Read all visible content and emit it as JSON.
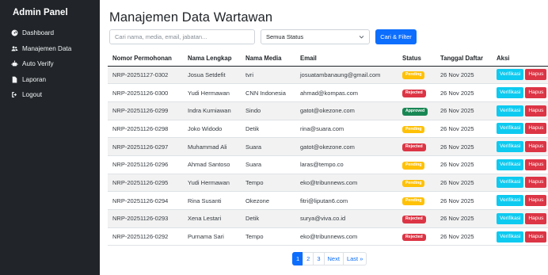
{
  "sidebar": {
    "brand": "Admin Panel",
    "items": [
      {
        "label": "Dashboard",
        "icon": "gauge-icon"
      },
      {
        "label": "Manajemen Data",
        "icon": "users-icon"
      },
      {
        "label": "Auto Verify",
        "icon": "robot-icon"
      },
      {
        "label": "Laporan",
        "icon": "file-icon"
      },
      {
        "label": "Logout",
        "icon": "logout-icon"
      }
    ]
  },
  "main": {
    "title": "Manajemen Data Wartawan",
    "search_placeholder": "Cari nama, media, email, jabatan...",
    "status_select": "Semua Status",
    "filter_button": "Cari & Filter"
  },
  "table": {
    "headers": [
      "Nomor Permohonan",
      "Nama Lengkap",
      "Nama Media",
      "Email",
      "Status",
      "Tanggal Daftar",
      "Aksi"
    ],
    "rows": [
      {
        "nomor": "NRP-20251127-0302",
        "nama": "Josua Setdefit",
        "media": "tvri",
        "email": "josuatambanaung@gmail.com",
        "status": "Pending",
        "tanggal": "26 Nov 2025"
      },
      {
        "nomor": "NRP-20251126-0300",
        "nama": "Yudi Hermawan",
        "media": "CNN Indonesia",
        "email": "ahmad@kompas.com",
        "status": "Rejected",
        "tanggal": "26 Nov 2025"
      },
      {
        "nomor": "NRP-20251126-0299",
        "nama": "Indra Kurniawan",
        "media": "Sindo",
        "email": "gatot@okezone.com",
        "status": "Approved",
        "tanggal": "26 Nov 2025"
      },
      {
        "nomor": "NRP-20251126-0298",
        "nama": "Joko Widodo",
        "media": "Detik",
        "email": "rina@suara.com",
        "status": "Pending",
        "tanggal": "26 Nov 2025"
      },
      {
        "nomor": "NRP-20251126-0297",
        "nama": "Muhammad Ali",
        "media": "Suara",
        "email": "gatot@okezone.com",
        "status": "Rejected",
        "tanggal": "26 Nov 2025"
      },
      {
        "nomor": "NRP-20251126-0296",
        "nama": "Ahmad Santoso",
        "media": "Suara",
        "email": "laras@tempo.co",
        "status": "Pending",
        "tanggal": "26 Nov 2025"
      },
      {
        "nomor": "NRP-20251126-0295",
        "nama": "Yudi Hermawan",
        "media": "Tempo",
        "email": "eko@tribunnews.com",
        "status": "Pending",
        "tanggal": "26 Nov 2025"
      },
      {
        "nomor": "NRP-20251126-0294",
        "nama": "Rina Susanti",
        "media": "Okezone",
        "email": "fitri@liputan6.com",
        "status": "Pending",
        "tanggal": "26 Nov 2025"
      },
      {
        "nomor": "NRP-20251126-0293",
        "nama": "Xena Lestari",
        "media": "Detik",
        "email": "surya@viva.co.id",
        "status": "Rejected",
        "tanggal": "26 Nov 2025"
      },
      {
        "nomor": "NRP-20251126-0292",
        "nama": "Purnama Sari",
        "media": "Tempo",
        "email": "eko@tribunnews.com",
        "status": "Rejected",
        "tanggal": "26 Nov 2025"
      }
    ],
    "action_verify": "Verifikasi",
    "action_delete": "Hapus"
  },
  "pagination": {
    "pages": [
      "1",
      "2",
      "3"
    ],
    "active": "1",
    "next": "Next",
    "last": "Last »"
  },
  "colors": {
    "sidebar_bg": "#212529",
    "primary": "#0d6efd",
    "info": "#0dcaf0",
    "danger": "#dc3545",
    "warning": "#ffc107",
    "success": "#198754"
  }
}
